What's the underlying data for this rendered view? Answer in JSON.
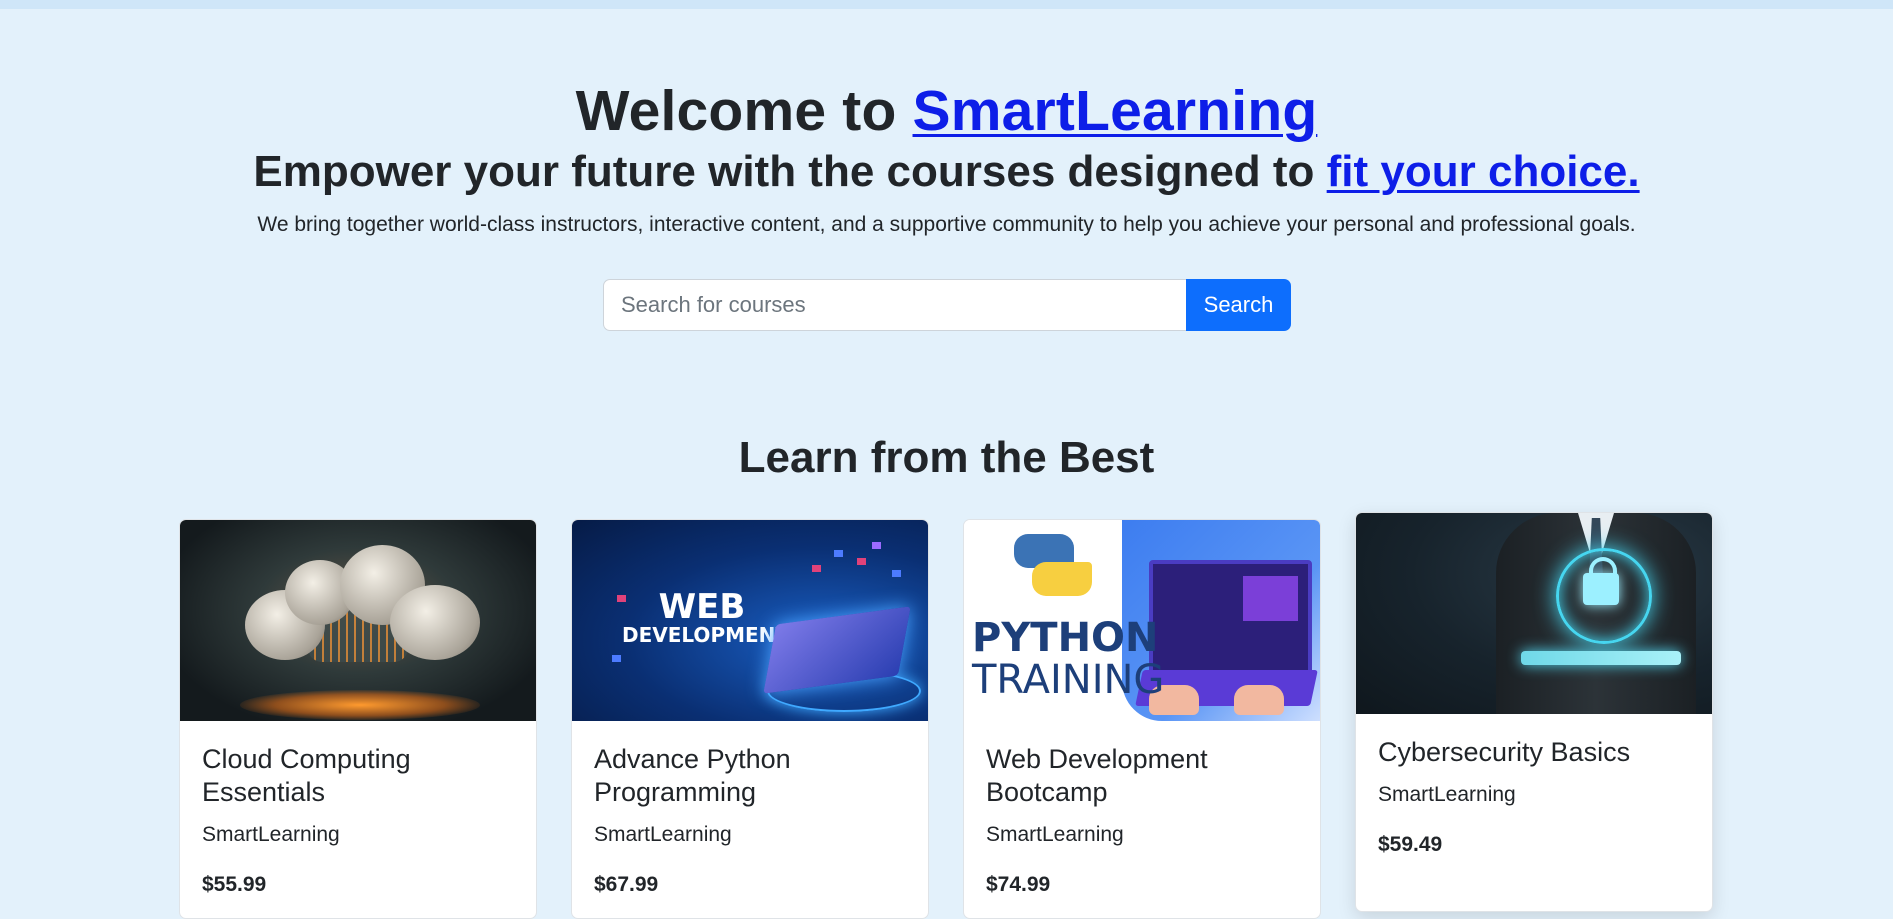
{
  "hero": {
    "title_prefix": "Welcome to ",
    "brand": "SmartLearning",
    "subtitle_prefix": "Empower your future with the courses designed to ",
    "subtitle_link": "fit your choice.",
    "description": "We bring together world-class instructors, interactive content, and a supportive community to help you achieve your personal and professional goals."
  },
  "search": {
    "placeholder": "Search for courses",
    "button_label": "Search"
  },
  "section": {
    "title": "Learn from the Best"
  },
  "courses": [
    {
      "title": "Cloud Computing Essentials",
      "provider": "SmartLearning",
      "price": "$55.99",
      "thumb": "cloud-computing-image"
    },
    {
      "title": "Advance Python Programming",
      "provider": "SmartLearning",
      "price": "$67.99",
      "thumb": "web-development-image",
      "thumb_text_1": "WEB",
      "thumb_text_2": "DEVELOPMENT"
    },
    {
      "title": "Web Development Bootcamp",
      "provider": "SmartLearning",
      "price": "$74.99",
      "thumb": "python-training-image",
      "thumb_text_1": "PYTHON",
      "thumb_text_2": "TRAINING"
    },
    {
      "title": "Cybersecurity Basics",
      "provider": "SmartLearning",
      "price": "$59.49",
      "thumb": "cybersecurity-image"
    }
  ],
  "colors": {
    "background": "#e3f1fb",
    "link": "#0d1ee8",
    "primary_button": "#0d6efd"
  }
}
